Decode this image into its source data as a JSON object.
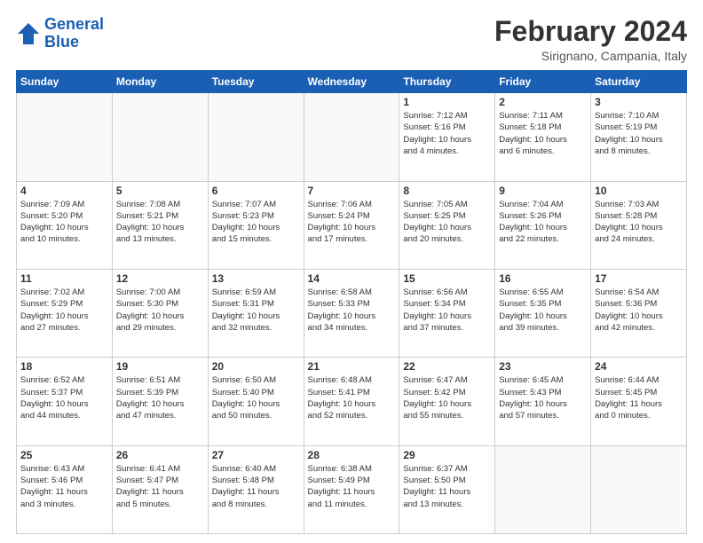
{
  "logo": {
    "line1": "General",
    "line2": "Blue"
  },
  "title": "February 2024",
  "subtitle": "Sirignano, Campania, Italy",
  "weekdays": [
    "Sunday",
    "Monday",
    "Tuesday",
    "Wednesday",
    "Thursday",
    "Friday",
    "Saturday"
  ],
  "weeks": [
    [
      {
        "day": "",
        "info": ""
      },
      {
        "day": "",
        "info": ""
      },
      {
        "day": "",
        "info": ""
      },
      {
        "day": "",
        "info": ""
      },
      {
        "day": "1",
        "info": "Sunrise: 7:12 AM\nSunset: 5:16 PM\nDaylight: 10 hours\nand 4 minutes."
      },
      {
        "day": "2",
        "info": "Sunrise: 7:11 AM\nSunset: 5:18 PM\nDaylight: 10 hours\nand 6 minutes."
      },
      {
        "day": "3",
        "info": "Sunrise: 7:10 AM\nSunset: 5:19 PM\nDaylight: 10 hours\nand 8 minutes."
      }
    ],
    [
      {
        "day": "4",
        "info": "Sunrise: 7:09 AM\nSunset: 5:20 PM\nDaylight: 10 hours\nand 10 minutes."
      },
      {
        "day": "5",
        "info": "Sunrise: 7:08 AM\nSunset: 5:21 PM\nDaylight: 10 hours\nand 13 minutes."
      },
      {
        "day": "6",
        "info": "Sunrise: 7:07 AM\nSunset: 5:23 PM\nDaylight: 10 hours\nand 15 minutes."
      },
      {
        "day": "7",
        "info": "Sunrise: 7:06 AM\nSunset: 5:24 PM\nDaylight: 10 hours\nand 17 minutes."
      },
      {
        "day": "8",
        "info": "Sunrise: 7:05 AM\nSunset: 5:25 PM\nDaylight: 10 hours\nand 20 minutes."
      },
      {
        "day": "9",
        "info": "Sunrise: 7:04 AM\nSunset: 5:26 PM\nDaylight: 10 hours\nand 22 minutes."
      },
      {
        "day": "10",
        "info": "Sunrise: 7:03 AM\nSunset: 5:28 PM\nDaylight: 10 hours\nand 24 minutes."
      }
    ],
    [
      {
        "day": "11",
        "info": "Sunrise: 7:02 AM\nSunset: 5:29 PM\nDaylight: 10 hours\nand 27 minutes."
      },
      {
        "day": "12",
        "info": "Sunrise: 7:00 AM\nSunset: 5:30 PM\nDaylight: 10 hours\nand 29 minutes."
      },
      {
        "day": "13",
        "info": "Sunrise: 6:59 AM\nSunset: 5:31 PM\nDaylight: 10 hours\nand 32 minutes."
      },
      {
        "day": "14",
        "info": "Sunrise: 6:58 AM\nSunset: 5:33 PM\nDaylight: 10 hours\nand 34 minutes."
      },
      {
        "day": "15",
        "info": "Sunrise: 6:56 AM\nSunset: 5:34 PM\nDaylight: 10 hours\nand 37 minutes."
      },
      {
        "day": "16",
        "info": "Sunrise: 6:55 AM\nSunset: 5:35 PM\nDaylight: 10 hours\nand 39 minutes."
      },
      {
        "day": "17",
        "info": "Sunrise: 6:54 AM\nSunset: 5:36 PM\nDaylight: 10 hours\nand 42 minutes."
      }
    ],
    [
      {
        "day": "18",
        "info": "Sunrise: 6:52 AM\nSunset: 5:37 PM\nDaylight: 10 hours\nand 44 minutes."
      },
      {
        "day": "19",
        "info": "Sunrise: 6:51 AM\nSunset: 5:39 PM\nDaylight: 10 hours\nand 47 minutes."
      },
      {
        "day": "20",
        "info": "Sunrise: 6:50 AM\nSunset: 5:40 PM\nDaylight: 10 hours\nand 50 minutes."
      },
      {
        "day": "21",
        "info": "Sunrise: 6:48 AM\nSunset: 5:41 PM\nDaylight: 10 hours\nand 52 minutes."
      },
      {
        "day": "22",
        "info": "Sunrise: 6:47 AM\nSunset: 5:42 PM\nDaylight: 10 hours\nand 55 minutes."
      },
      {
        "day": "23",
        "info": "Sunrise: 6:45 AM\nSunset: 5:43 PM\nDaylight: 10 hours\nand 57 minutes."
      },
      {
        "day": "24",
        "info": "Sunrise: 6:44 AM\nSunset: 5:45 PM\nDaylight: 11 hours\nand 0 minutes."
      }
    ],
    [
      {
        "day": "25",
        "info": "Sunrise: 6:43 AM\nSunset: 5:46 PM\nDaylight: 11 hours\nand 3 minutes."
      },
      {
        "day": "26",
        "info": "Sunrise: 6:41 AM\nSunset: 5:47 PM\nDaylight: 11 hours\nand 5 minutes."
      },
      {
        "day": "27",
        "info": "Sunrise: 6:40 AM\nSunset: 5:48 PM\nDaylight: 11 hours\nand 8 minutes."
      },
      {
        "day": "28",
        "info": "Sunrise: 6:38 AM\nSunset: 5:49 PM\nDaylight: 11 hours\nand 11 minutes."
      },
      {
        "day": "29",
        "info": "Sunrise: 6:37 AM\nSunset: 5:50 PM\nDaylight: 11 hours\nand 13 minutes."
      },
      {
        "day": "",
        "info": ""
      },
      {
        "day": "",
        "info": ""
      }
    ]
  ]
}
